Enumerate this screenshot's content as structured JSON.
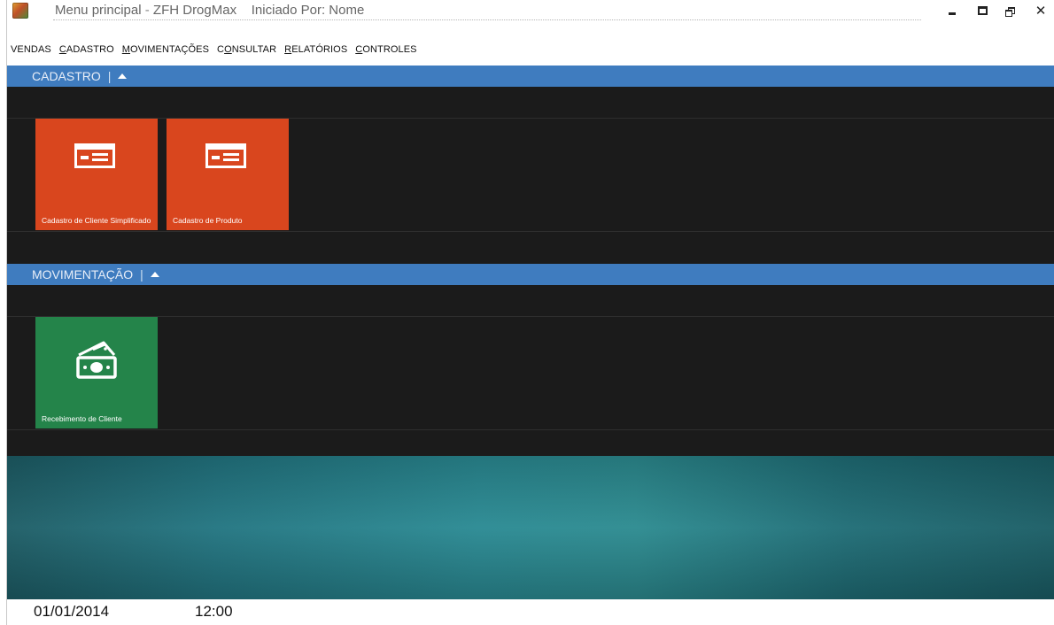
{
  "window": {
    "title": "Menu principal",
    "app_name": "ZFH DrogMax",
    "started_by": "Iniciado Por: Nome",
    "controls": {
      "close": "✕"
    }
  },
  "menu": [
    {
      "label": "VENDAS"
    },
    {
      "label": "CADASTRO",
      "accel": "C",
      "rest": "ADASTRO"
    },
    {
      "label": "MOVIMENTAÇÕES",
      "accel": "M",
      "rest": "OVIMENTAÇÕES"
    },
    {
      "label": "CONSULTAR",
      "pre": "C",
      "accel": "O",
      "rest": "NSULTAR"
    },
    {
      "label": "RELATÓRIOS",
      "accel": "R",
      "rest": "ELATÓRIOS"
    },
    {
      "label": "CONTROLES",
      "accel": "C",
      "rest": "ONTROLES"
    }
  ],
  "groups": {
    "cadastro": {
      "title": "CADASTRO",
      "tiles": [
        {
          "label": "Cadastro de Cliente Simplificado",
          "icon": "id-card-icon",
          "color": "#d9461e"
        },
        {
          "label": "Cadastro de Produto",
          "icon": "id-card-icon",
          "color": "#d9461e"
        }
      ]
    },
    "movimentacao": {
      "title": "MOVIMENTAÇÃO",
      "tiles": [
        {
          "label": "Recebimento de Cliente",
          "icon": "money-icon",
          "color": "#24844a"
        }
      ]
    }
  },
  "status": {
    "date": "01/01/2014",
    "time": "12:00"
  },
  "colors": {
    "header_blue": "#3f7cbf",
    "background": "#1b1b1b",
    "tile_orange": "#d9461e",
    "tile_green": "#24844a"
  }
}
